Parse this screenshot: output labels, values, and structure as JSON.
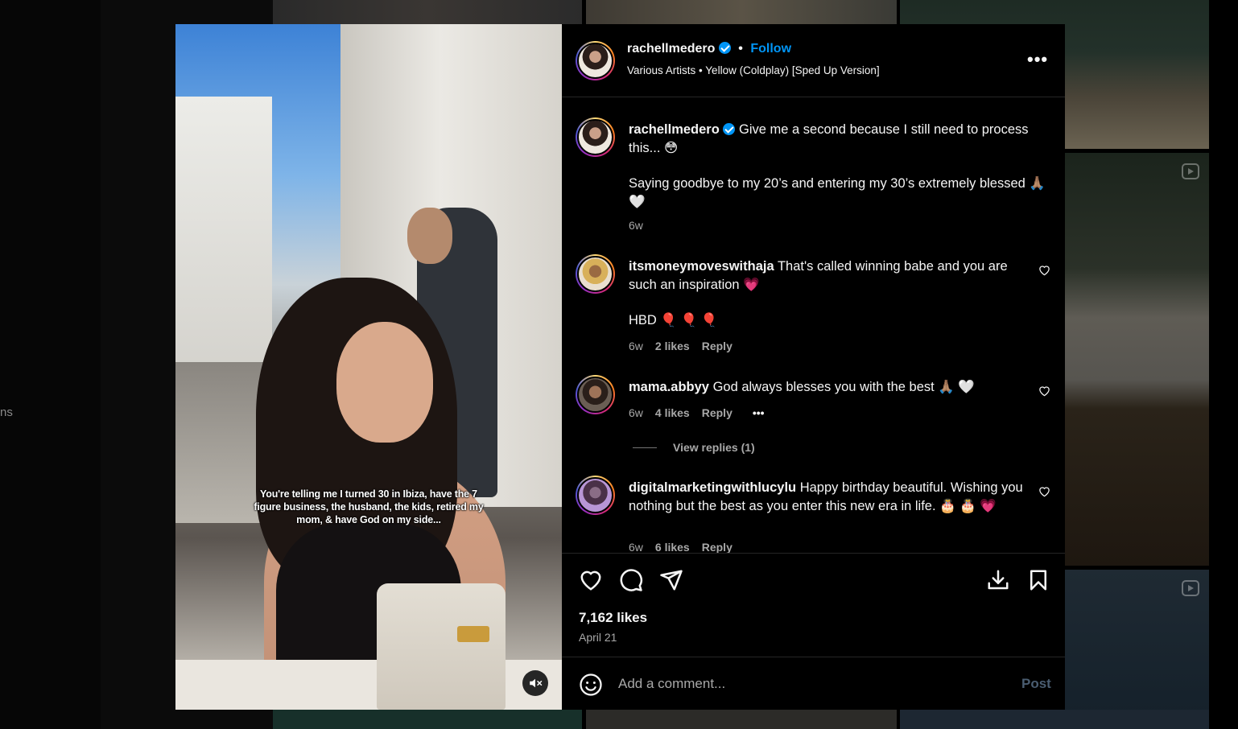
{
  "background": {
    "side_fragment": "ns"
  },
  "media": {
    "caption_overlay": "You're telling me I turned 30 in Ibiza, have the 7 figure business, the husband, the kids, retired my mom, & have God on my side...",
    "mute_icon": "speaker-muted-icon"
  },
  "header": {
    "username": "rachellmedero",
    "separator": "•",
    "follow_label": "Follow",
    "audio_artist": "Various Artists",
    "audio_separator": "•",
    "audio_track": "Yellow (Coldplay) [Sped Up Version]",
    "more_label": "•••"
  },
  "caption": {
    "username": "rachellmedero",
    "text_line1": "Give me a second because I still need to process this... 😳",
    "text_line2": "Saying goodbye to my 20’s and entering my 30’s extremely blessed 🙏🏽 🤍",
    "time": "6w"
  },
  "comments": [
    {
      "username": "itsmoneymoveswithaja",
      "text": "That's called winning babe and you are such an inspiration 💗",
      "text2": "HBD 🎈 🎈 🎈",
      "time": "6w",
      "likes": "2 likes",
      "reply": "Reply"
    },
    {
      "username": "mama.abbyy",
      "text": "God always blesses you with the best 🙏🏽 🤍",
      "time": "6w",
      "likes": "4 likes",
      "reply": "Reply",
      "more": "•••",
      "view_replies": "View replies (1)"
    },
    {
      "username": "digitalmarketingwithlucylu",
      "text": "Happy birthday beautiful. Wishing you nothing but the best as you enter this new era in life. 🎂 🎂 💗",
      "time": "6w",
      "likes": "6 likes",
      "reply": "Reply"
    }
  ],
  "actions": {
    "like_icon": "heart-icon",
    "comment_icon": "comment-icon",
    "share_icon": "share-icon",
    "download_icon": "download-icon",
    "save_icon": "bookmark-icon",
    "likes_count": "7,162 likes",
    "date": "April 21"
  },
  "add_comment": {
    "placeholder": "Add a comment...",
    "post_label": "Post"
  }
}
